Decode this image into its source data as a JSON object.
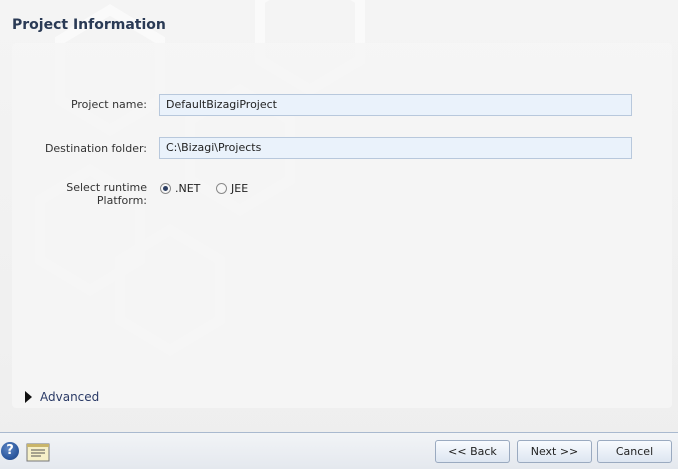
{
  "page": {
    "title": "Project Information"
  },
  "form": {
    "project_name_label": "Project name:",
    "project_name_value": "DefaultBizagiProject",
    "destination_label": "Destination folder:",
    "destination_value": "C:\\Bizagi\\Projects",
    "platform_label": "Select runtime Platform:",
    "platforms": [
      {
        "label": ".NET",
        "selected": true
      },
      {
        "label": "JEE",
        "selected": false
      }
    ],
    "advanced_label": "Advanced"
  },
  "footer": {
    "back_label": "<< Back",
    "next_label": "Next >>",
    "cancel_label": "Cancel",
    "help_icon": "help-icon",
    "notes_icon": "notes-icon"
  },
  "colors": {
    "title": "#2a3a55",
    "input_bg": "#eaf2fb",
    "accent": "#2a3a66"
  }
}
